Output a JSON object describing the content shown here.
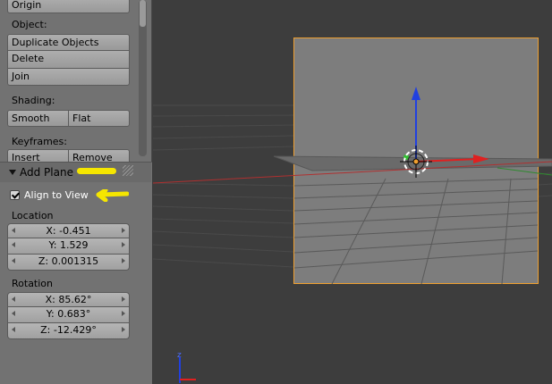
{
  "toolshelf": {
    "origin_label": "Origin",
    "object_section": "Object:",
    "duplicate_label": "Duplicate Objects",
    "delete_label": "Delete",
    "join_label": "Join",
    "shading_section": "Shading:",
    "smooth_label": "Smooth",
    "flat_label": "Flat",
    "keyframes_section": "Keyframes:",
    "insert_label": "Insert",
    "remove_label": "Remove"
  },
  "operator": {
    "title": "Add Plane",
    "align_to_view_label": "Align to View",
    "align_to_view_checked": true,
    "location_label": "Location",
    "location": {
      "x": "X: -0.451",
      "y": "Y: 1.529",
      "z": "Z: 0.001315"
    },
    "rotation_label": "Rotation",
    "rotation": {
      "x": "X: 85.62°",
      "y": "Y: 0.683°",
      "z": "Z: -12.429°"
    }
  },
  "colors": {
    "annotation": "#f5e600",
    "axis_x": "#e02020",
    "axis_y": "#30c030",
    "axis_z": "#2040e0",
    "selection": "#f0a030"
  }
}
